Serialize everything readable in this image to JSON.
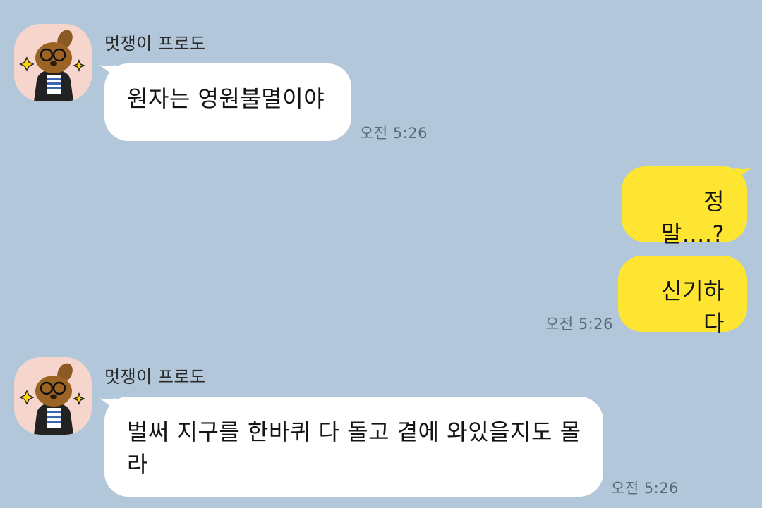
{
  "colors": {
    "background": "#b2c7d9",
    "incoming_bubble": "#ffffff",
    "outgoing_bubble": "#fee532",
    "timestamp": "#5b6b78",
    "avatar_bg": "#f6d6cc"
  },
  "messages": [
    {
      "direction": "incoming",
      "sender": "멋쟁이 프로도",
      "avatar_icon": "frodo-character-icon",
      "text": "원자는 영원불멸이야",
      "time": "오전 5:26"
    },
    {
      "direction": "outgoing",
      "text": "정말....?"
    },
    {
      "direction": "outgoing",
      "text": "신기하다",
      "time": "오전 5:26"
    },
    {
      "direction": "incoming",
      "sender": "멋쟁이 프로도",
      "avatar_icon": "frodo-character-icon",
      "text": "벌써 지구를 한바퀴 다 돌고 곁에 와있을지도 몰라",
      "time": "오전 5:26"
    }
  ]
}
